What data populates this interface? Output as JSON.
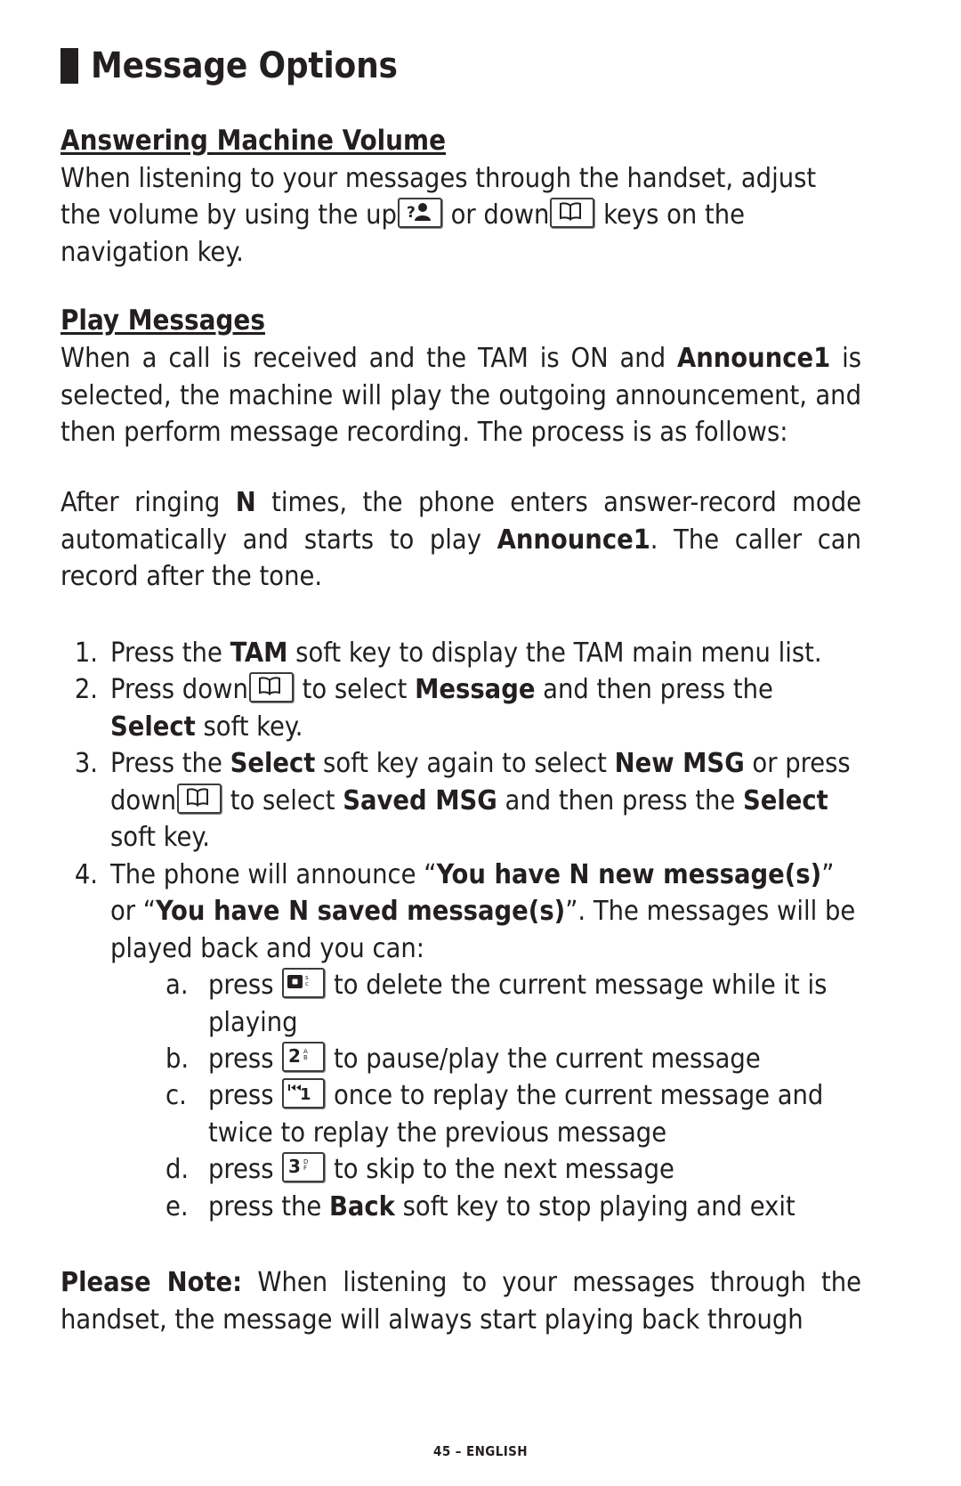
{
  "page": {
    "title": "Message Options",
    "footer": "45 – ENGLISH",
    "language": "ENGLISH",
    "page_number": "45"
  },
  "sections": [
    {
      "heading": "Answering Machine Volume",
      "paragraph_part1": "When listening to your messages through the handset, adjust the volume by using the up",
      "paragraph_part2": " or down",
      "paragraph_part3": " keys on the navigation key."
    },
    {
      "heading": "Play Messages",
      "para1_a": "When a call is received and the TAM is ON and ",
      "para1_b": "Announce1",
      "para1_c": " is selected, the machine will play the outgoing announcement, and then perform message recording. The process is as follows:",
      "para2_a": "After ringing ",
      "para2_b": "N",
      "para2_c": " times, the phone enters answer-record mode automatically and starts to play ",
      "para2_d": "Announce1",
      "para2_e": ". The caller can record after the tone."
    }
  ],
  "steps": [
    {
      "number": "1.",
      "t1": "Press the ",
      "b1": "TAM",
      "t2": " soft key to display the TAM main menu list."
    },
    {
      "number": "2.",
      "t1": "Press down",
      "icon": "phonebook-key-icon",
      "t2": " to select ",
      "b1": "Message",
      "t3": " and then press the ",
      "b2": "Select",
      "t4": " soft key."
    },
    {
      "number": "3.",
      "t1": "Press the ",
      "b1": "Select",
      "t2": " soft key again to select ",
      "b2": "New MSG",
      "t3": " or press down",
      "icon": "phonebook-key-icon",
      "t4": " to select ",
      "b3": "Saved MSG",
      "t5": " and then press the ",
      "b4": "Select",
      "t6": " soft key."
    },
    {
      "number": "4.",
      "t1": "The phone will announce “",
      "b1": "You have N new message(s)",
      "t2": "” or “",
      "b2": "You have N saved message(s)",
      "t3": "”.  The messages will be played back and you can:"
    }
  ],
  "substeps": [
    {
      "letter": "a.",
      "t1": "press ",
      "icon": "key-0-delete-icon",
      "icon_label": "0",
      "t2": " to delete the current message while it is playing"
    },
    {
      "letter": "b.",
      "t1": "press ",
      "icon": "key-2-pause-play-icon",
      "icon_label": "2",
      "t2": " to pause/play the current message"
    },
    {
      "letter": "c.",
      "t1": "press ",
      "icon": "key-1-replay-icon",
      "icon_label": "1",
      "t2": " once to replay the current message and twice to replay the previous message"
    },
    {
      "letter": "d.",
      "t1": "press ",
      "icon": "key-3-skip-icon",
      "icon_label": "3",
      "t2": " to skip to the next message"
    },
    {
      "letter": "e.",
      "t1": "press the ",
      "b1": "Back",
      "t2": " soft key to stop playing and exit"
    }
  ],
  "note": {
    "label": "Please Note:",
    "text": " When listening to your messages through the handset, the message will always start playing back through"
  },
  "colors": {
    "text": "#231f20",
    "background": "#ffffff",
    "keycap_border": "#3b3b3b",
    "keycap_shadow": "#8a8a8a"
  }
}
